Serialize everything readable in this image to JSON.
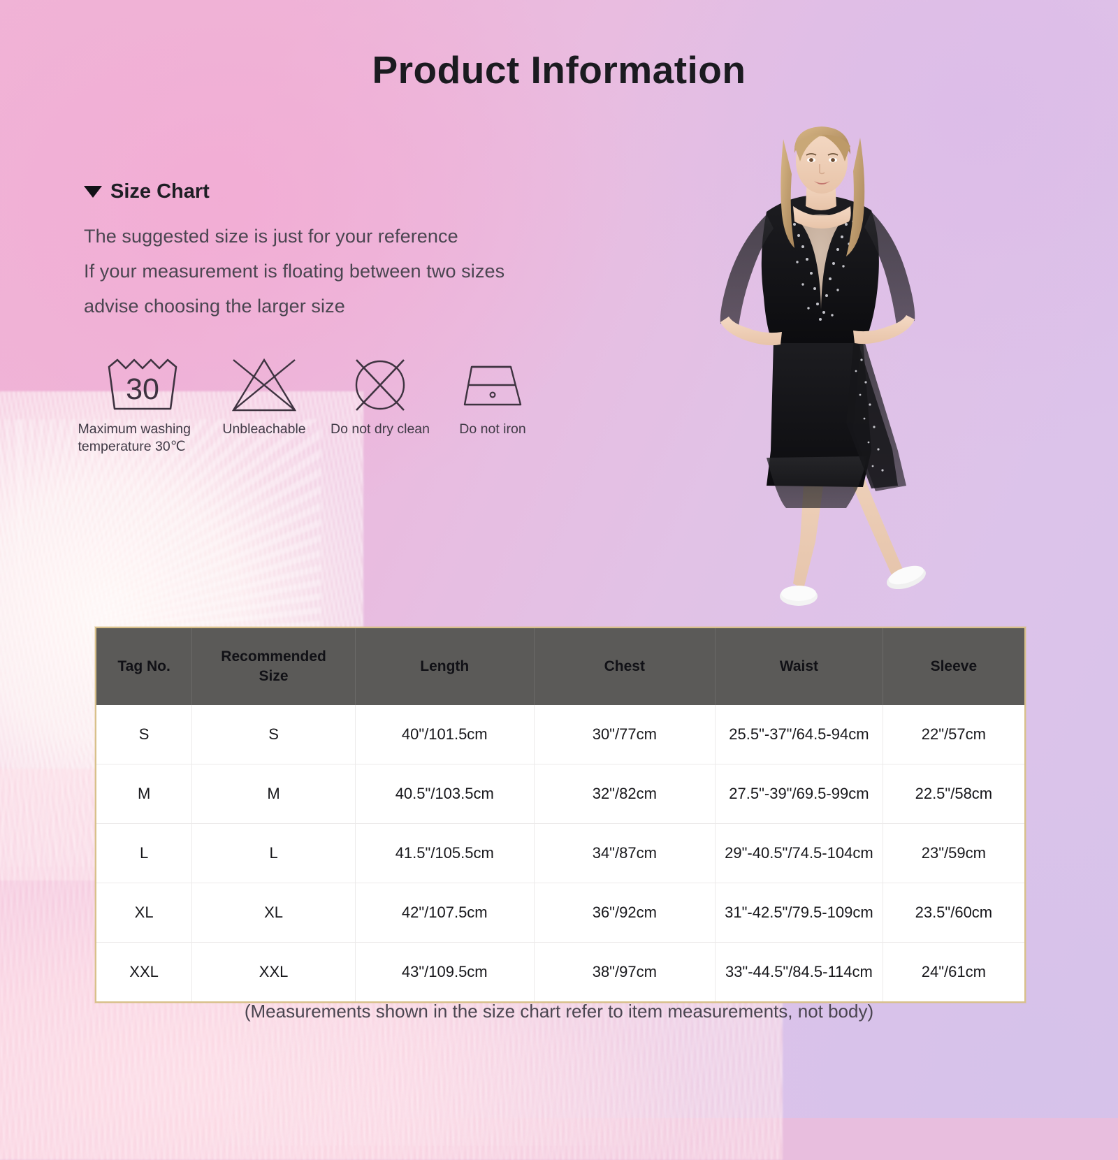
{
  "page": {
    "title": "Product  Information",
    "footnote": "(Measurements shown in the size chart refer to item measurements, not body)"
  },
  "size_chart": {
    "heading": "Size Chart",
    "heading_marker": "triangle-down",
    "notes": [
      "The suggested size is just for your reference",
      "If your measurement is floating between two sizes",
      "advise choosing the larger size"
    ]
  },
  "care_symbols": [
    {
      "id": "max-wash-temp",
      "icon": "wash-tub-30-icon",
      "value": "30",
      "label": "Maximum washing\ntemperature 30℃"
    },
    {
      "id": "unbleachable",
      "icon": "no-bleach-icon",
      "label": "Unbleachable"
    },
    {
      "id": "no-dry-clean",
      "icon": "no-dry-clean-icon",
      "label": "Do not dry clean"
    },
    {
      "id": "no-iron",
      "icon": "no-iron-icon",
      "label": "Do not iron"
    }
  ],
  "product_photo": {
    "alt": "Model wearing black rhinestone mesh dance dress with white ballet shoes"
  },
  "table": {
    "headers": [
      "Tag No.",
      "Recommended Size",
      "Length",
      "Chest",
      "Waist",
      "Sleeve"
    ],
    "header_lines": {
      "recommended_1": "Recommended",
      "recommended_2": "Size"
    },
    "rows": [
      {
        "tag": "S",
        "recommended": "S",
        "length": "40\"/101.5cm",
        "chest": "30\"/77cm",
        "waist": "25.5\"-37\"/64.5-94cm",
        "sleeve": "22\"/57cm"
      },
      {
        "tag": "M",
        "recommended": "M",
        "length": "40.5\"/103.5cm",
        "chest": "32\"/82cm",
        "waist": "27.5\"-39\"/69.5-99cm",
        "sleeve": "22.5\"/58cm"
      },
      {
        "tag": "L",
        "recommended": "L",
        "length": "41.5\"/105.5cm",
        "chest": "34\"/87cm",
        "waist": "29\"-40.5\"/74.5-104cm",
        "sleeve": "23\"/59cm"
      },
      {
        "tag": "XL",
        "recommended": "XL",
        "length": "42\"/107.5cm",
        "chest": "36\"/92cm",
        "waist": "31\"-42.5\"/79.5-109cm",
        "sleeve": "23.5\"/60cm"
      },
      {
        "tag": "XXL",
        "recommended": "XXL",
        "length": "43\"/109.5cm",
        "chest": "38\"/97cm",
        "waist": "33\"-44.5\"/84.5-114cm",
        "sleeve": "24\"/61cm"
      }
    ]
  },
  "colors": {
    "bg_pink": "#f0b4d6",
    "bg_lavender": "#d8c3ea",
    "table_header_bg": "#5b5a58",
    "table_border": "#d8c08a",
    "title_text": "#1b1b20",
    "body_text": "#4a4550",
    "cell_text": "#17171b"
  }
}
